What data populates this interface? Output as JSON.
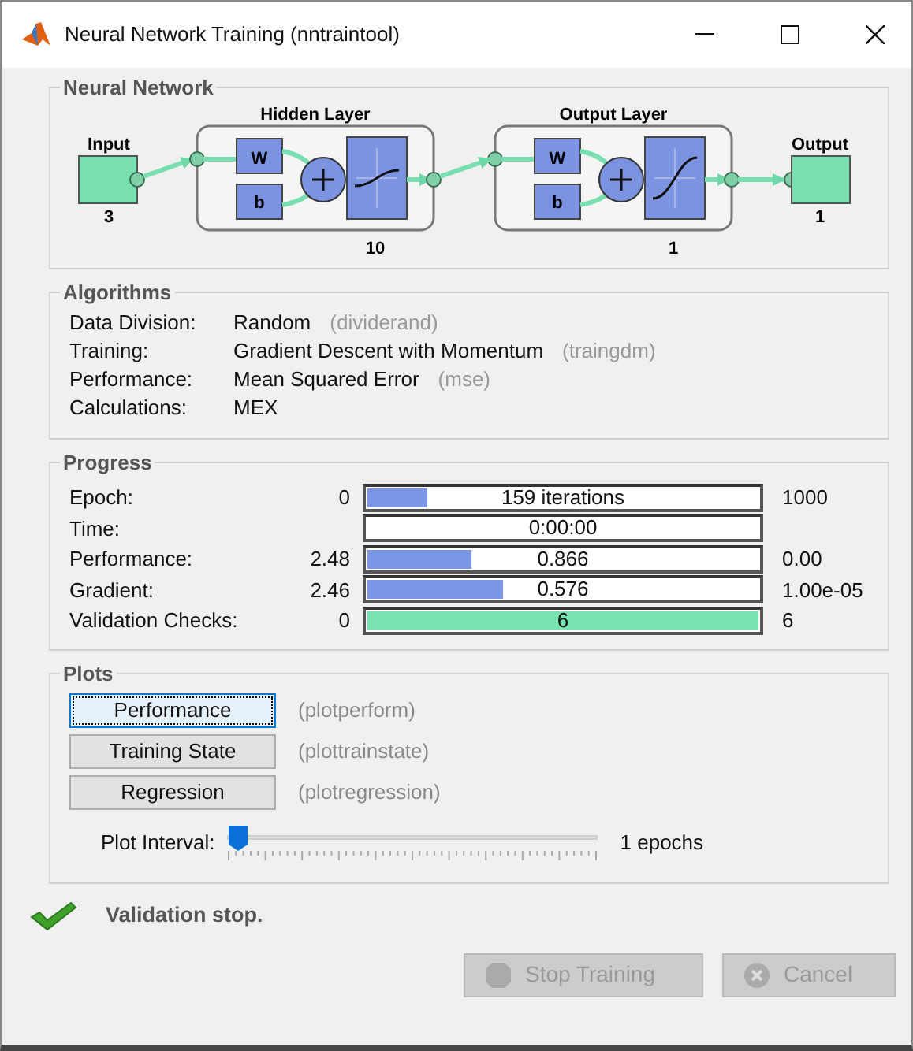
{
  "window": {
    "title": "Neural Network Training (nntraintool)"
  },
  "network": {
    "title": "Neural Network",
    "input": {
      "label": "Input",
      "size": "3"
    },
    "layers": [
      {
        "title": "Hidden Layer",
        "weight": "W",
        "bias": "b",
        "size": "10"
      },
      {
        "title": "Output Layer",
        "weight": "W",
        "bias": "b",
        "size": "1"
      }
    ],
    "output": {
      "label": "Output",
      "size": "1"
    }
  },
  "algorithms": {
    "title": "Algorithms",
    "rows": [
      {
        "label": "Data Division:",
        "value": "Random",
        "function": "(dividerand)"
      },
      {
        "label": "Training:",
        "value": "Gradient Descent with Momentum",
        "function": "(traingdm)"
      },
      {
        "label": "Performance:",
        "value": "Mean Squared Error",
        "function": "(mse)"
      },
      {
        "label": "Calculations:",
        "value": "MEX"
      }
    ]
  },
  "progress": {
    "title": "Progress",
    "rows": [
      {
        "label": "Epoch:",
        "start": "0",
        "text": "159 iterations",
        "end": "1000",
        "level": 0.16,
        "kind": "blue"
      },
      {
        "label": "Time:",
        "text": "0:00:00",
        "level": 0,
        "kind": "blue"
      },
      {
        "label": "Performance:",
        "start": "2.48",
        "text": "0.866",
        "end": "0.00",
        "level": 0.27,
        "kind": "blue"
      },
      {
        "label": "Gradient:",
        "start": "2.46",
        "text": "0.576",
        "end": "1.00e-05",
        "level": 0.35,
        "kind": "blue"
      },
      {
        "label": "Validation Checks:",
        "start": "0",
        "text": "6",
        "end": "6",
        "level": 1,
        "kind": "green"
      }
    ]
  },
  "plots": {
    "title": "Plots",
    "buttons": [
      {
        "label": "Performance",
        "function": "(plotperform)",
        "focused": true
      },
      {
        "label": "Training State",
        "function": "(plottrainstate)",
        "focused": false
      },
      {
        "label": "Regression",
        "function": "(plotregression)",
        "focused": false
      }
    ],
    "interval": {
      "label": "Plot Interval:",
      "level": 0,
      "reading": "1 epochs"
    }
  },
  "status": {
    "text": "Validation stop."
  },
  "buttons": [
    {
      "label": "Stop Training",
      "kind": "stop",
      "disabled": true
    },
    {
      "label": "Cancel",
      "kind": "cancel",
      "disabled": true
    }
  ]
}
